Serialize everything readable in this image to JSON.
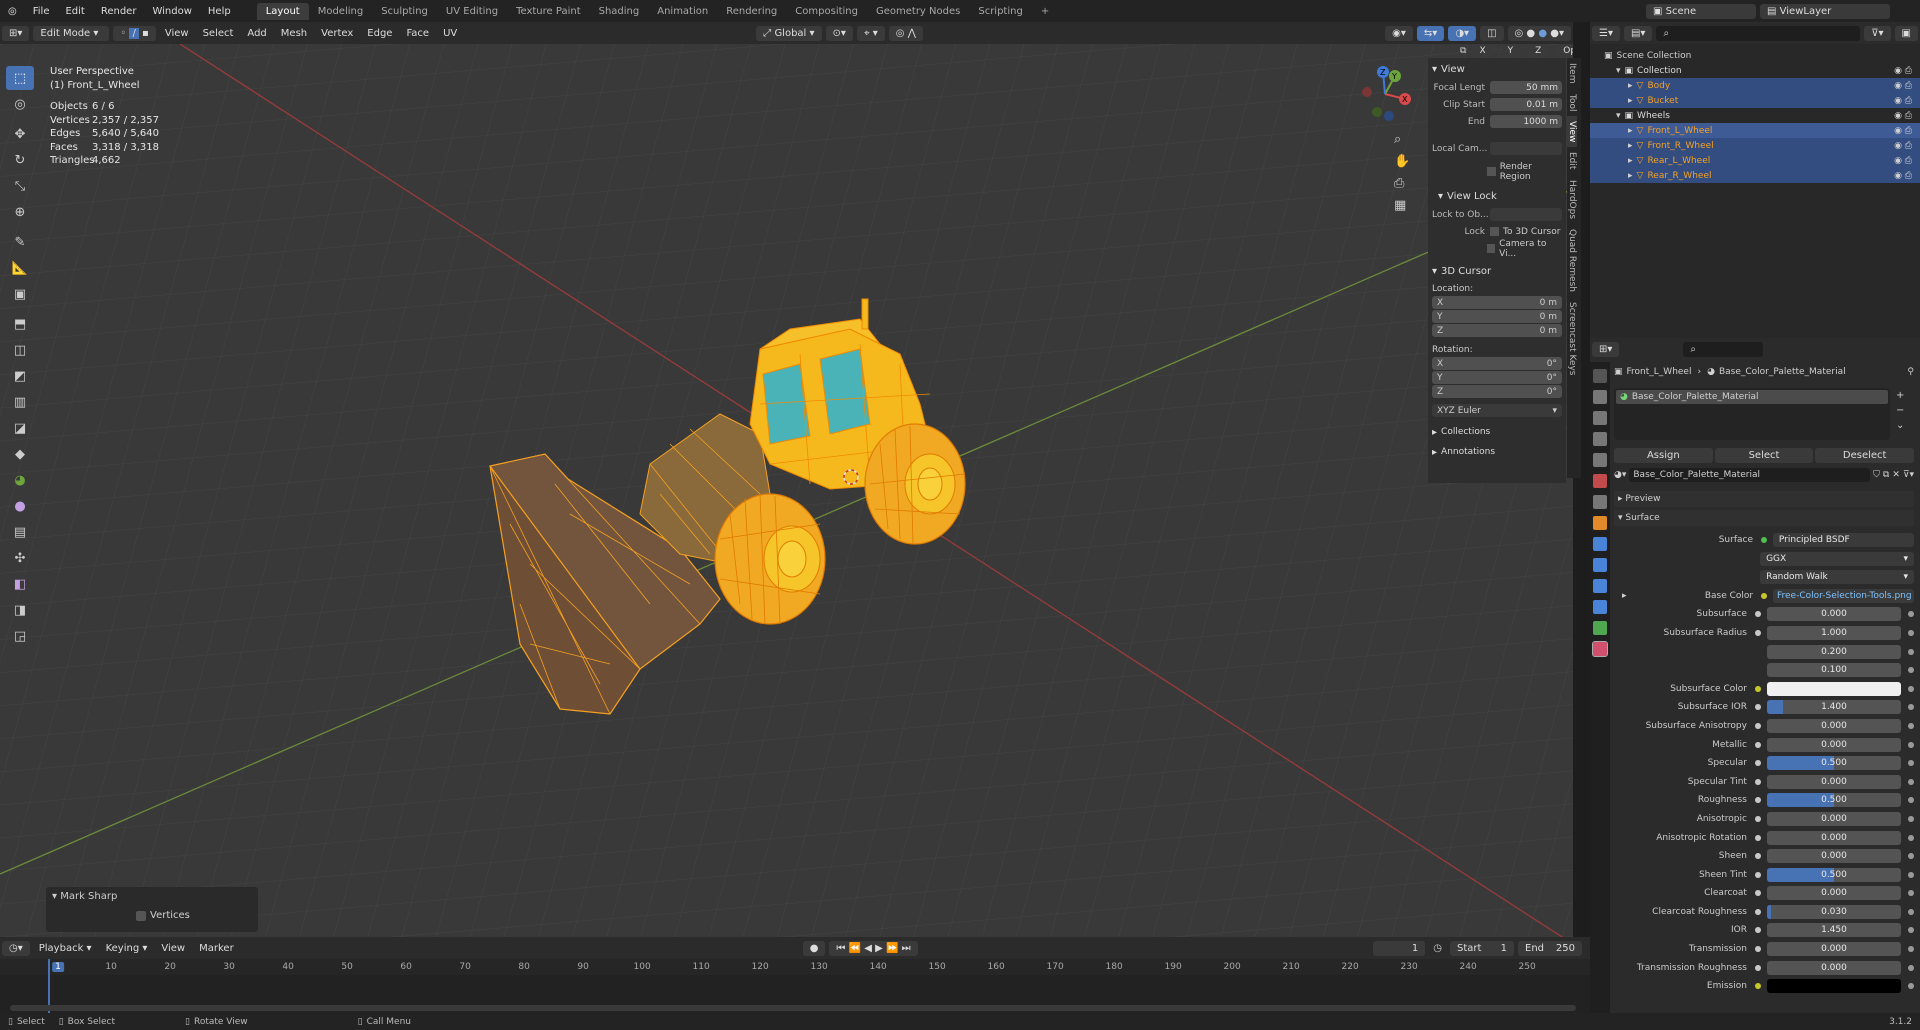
{
  "topbar": {
    "menus": [
      "File",
      "Edit",
      "Render",
      "Window",
      "Help"
    ],
    "workspaces": [
      "Layout",
      "Modeling",
      "Sculpting",
      "UV Editing",
      "Texture Paint",
      "Shading",
      "Animation",
      "Rendering",
      "Compositing",
      "Geometry Nodes",
      "Scripting"
    ],
    "active_workspace": "Layout",
    "add_tab": "+",
    "scene": "Scene",
    "view_layer": "ViewLayer"
  },
  "viewport_header": {
    "mode": "Edit Mode",
    "menus": [
      "View",
      "Select",
      "Add",
      "Mesh",
      "Vertex",
      "Edge",
      "Face",
      "UV"
    ],
    "orientation": "Global",
    "options": "Options",
    "axes": [
      "X",
      "Y",
      "Z"
    ]
  },
  "overlay": {
    "perspective": "User Perspective",
    "object": "(1) Front_L_Wheel",
    "stats": [
      {
        "label": "Objects",
        "value": "6 / 6"
      },
      {
        "label": "Vertices",
        "value": "2,357 / 2,357"
      },
      {
        "label": "Edges",
        "value": "5,640 / 5,640"
      },
      {
        "label": "Faces",
        "value": "3,318 / 3,318"
      },
      {
        "label": "Triangles",
        "value": "4,662"
      }
    ]
  },
  "gizmo": {
    "x": "X",
    "y": "Y",
    "z": "Z"
  },
  "npanel": {
    "view_header": "View",
    "focal_label": "Focal Lengt",
    "focal_value": "50 mm",
    "clip_start_label": "Clip Start",
    "clip_start_value": "0.01 m",
    "end_label": "End",
    "end_value": "1000 m",
    "local_cam_label": "Local Cam...",
    "render_region": "Render Region",
    "view_lock_header": "View Lock",
    "lock_to_obj_label": "Lock to Ob...",
    "lock_label": "Lock",
    "to_3d_cursor": "To 3D Cursor",
    "camera_to_view": "Camera to Vi...",
    "cursor_header": "3D Cursor",
    "location_label": "Location:",
    "location": [
      {
        "axis": "X",
        "value": "0 m"
      },
      {
        "axis": "Y",
        "value": "0 m"
      },
      {
        "axis": "Z",
        "value": "0 m"
      }
    ],
    "rotation_label": "Rotation:",
    "rotation": [
      {
        "axis": "X",
        "value": "0°"
      },
      {
        "axis": "Y",
        "value": "0°"
      },
      {
        "axis": "Z",
        "value": "0°"
      }
    ],
    "rotation_mode": "XYZ Euler",
    "collections_header": "Collections",
    "annotations_header": "Annotations",
    "tabs": [
      "Item",
      "Tool",
      "View",
      "Edit",
      "HardOps",
      "Quad Remesh",
      "Screencast Keys"
    ]
  },
  "mark_sharp": {
    "title": "Mark Sharp",
    "vertices": "Vertices"
  },
  "outliner": {
    "root": "Scene Collection",
    "items": [
      {
        "name": "Collection",
        "depth": 1,
        "type": "collection",
        "selected": false
      },
      {
        "name": "Body",
        "depth": 2,
        "type": "object",
        "selected": true
      },
      {
        "name": "Bucket",
        "depth": 2,
        "type": "object",
        "selected": true
      },
      {
        "name": "Wheels",
        "depth": 1,
        "type": "collection",
        "selected": false
      },
      {
        "name": "Front_L_Wheel",
        "depth": 2,
        "type": "object",
        "selected": true,
        "active": true
      },
      {
        "name": "Front_R_Wheel",
        "depth": 2,
        "type": "object",
        "selected": true
      },
      {
        "name": "Rear_L_Wheel",
        "depth": 2,
        "type": "object",
        "selected": true
      },
      {
        "name": "Rear_R_Wheel",
        "depth": 2,
        "type": "object",
        "selected": true
      }
    ]
  },
  "properties": {
    "breadcrumb_object": "Front_L_Wheel",
    "breadcrumb_material": "Base_Color_Palette_Material",
    "slot": "Base_Color_Palette_Material",
    "assign": "Assign",
    "select": "Select",
    "deselect": "Deselect",
    "material_name": "Base_Color_Palette_Material",
    "preview": "Preview",
    "surface_header": "Surface",
    "surface_label": "Surface",
    "surface_value": "Principled BSDF",
    "distribution": "GGX",
    "subsurface_method": "Random Walk",
    "base_color_label": "Base Color",
    "base_color_value": "Free-Color-Selection-Tools.png",
    "rows": [
      {
        "label": "Subsurface",
        "value": "0.000",
        "fill": 0
      },
      {
        "label": "Subsurface Radius",
        "value": "1.000",
        "fill": 0
      },
      {
        "label": "",
        "value": "0.200",
        "fill": 0
      },
      {
        "label": "",
        "value": "0.100",
        "fill": 0
      },
      {
        "label": "Subsurface Color",
        "value": "",
        "fill": 0,
        "color": "#f0f0f0"
      },
      {
        "label": "Subsurface IOR",
        "value": "1.400",
        "fill": 0.12
      },
      {
        "label": "Subsurface Anisotropy",
        "value": "0.000",
        "fill": 0
      },
      {
        "label": "Metallic",
        "value": "0.000",
        "fill": 0
      },
      {
        "label": "Specular",
        "value": "0.500",
        "fill": 0.5
      },
      {
        "label": "Specular Tint",
        "value": "0.000",
        "fill": 0
      },
      {
        "label": "Roughness",
        "value": "0.500",
        "fill": 0.5
      },
      {
        "label": "Anisotropic",
        "value": "0.000",
        "fill": 0
      },
      {
        "label": "Anisotropic Rotation",
        "value": "0.000",
        "fill": 0
      },
      {
        "label": "Sheen",
        "value": "0.000",
        "fill": 0
      },
      {
        "label": "Sheen Tint",
        "value": "0.500",
        "fill": 0.5
      },
      {
        "label": "Clearcoat",
        "value": "0.000",
        "fill": 0
      },
      {
        "label": "Clearcoat Roughness",
        "value": "0.030",
        "fill": 0.03
      },
      {
        "label": "IOR",
        "value": "1.450",
        "fill": 0
      },
      {
        "label": "Transmission",
        "value": "0.000",
        "fill": 0
      },
      {
        "label": "Transmission Roughness",
        "value": "0.000",
        "fill": 0
      },
      {
        "label": "Emission",
        "value": "",
        "fill": 0,
        "color": "#000000"
      }
    ]
  },
  "timeline": {
    "menus": [
      "Playback",
      "Keying",
      "View",
      "Marker"
    ],
    "current_frame": "1",
    "start_label": "Start",
    "start": "1",
    "end_label": "End",
    "end": "250",
    "ticks": [
      "1",
      "10",
      "20",
      "30",
      "40",
      "50",
      "60",
      "70",
      "80",
      "90",
      "100",
      "110",
      "120",
      "130",
      "140",
      "150",
      "160",
      "170",
      "180",
      "190",
      "200",
      "210",
      "220",
      "230",
      "240",
      "250"
    ]
  },
  "statusbar": {
    "select": "Select",
    "box_select": "Box Select",
    "rotate_view": "Rotate View",
    "call_menu": "Call Menu",
    "version": "3.1.2"
  },
  "colors": {
    "accent": "#4772b3",
    "selection_orange": "#f5a020",
    "grid_bg": "#393939"
  }
}
